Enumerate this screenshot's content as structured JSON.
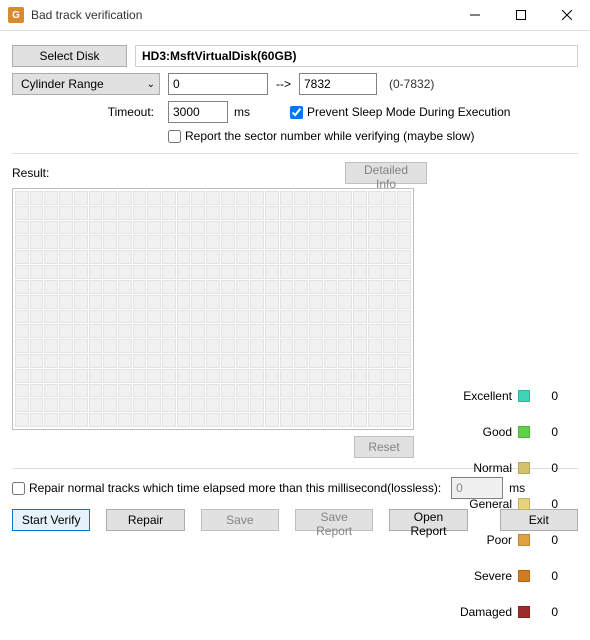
{
  "window": {
    "title": "Bad track verification"
  },
  "toolbar": {
    "select_disk": "Select Disk",
    "disk_label": "HD3:MsftVirtualDisk(60GB)"
  },
  "range": {
    "mode": "Cylinder Range",
    "from": "0",
    "to": "7832",
    "hint": "(0-7832)"
  },
  "timeout": {
    "label": "Timeout:",
    "value": "3000",
    "unit": "ms"
  },
  "checks": {
    "prevent_sleep": {
      "label": "Prevent Sleep Mode During Execution",
      "checked": true
    },
    "report_sector": {
      "label": "Report the sector number while verifying (maybe slow)",
      "checked": false
    }
  },
  "result": {
    "label": "Result:",
    "detailed": "Detailed Info",
    "reset": "Reset"
  },
  "legend": [
    {
      "name": "Excellent",
      "color": "#3fd4b8",
      "value": "0"
    },
    {
      "name": "Good",
      "color": "#62d14a",
      "value": "0"
    },
    {
      "name": "Normal",
      "color": "#d3c26b",
      "value": "0"
    },
    {
      "name": "General",
      "color": "#e7d37a",
      "value": "0"
    },
    {
      "name": "Poor",
      "color": "#e0a142",
      "value": "0"
    },
    {
      "name": "Severe",
      "color": "#d17a1f",
      "value": "0"
    },
    {
      "name": "Damaged",
      "color": "#9e2b2b",
      "value": "0"
    }
  ],
  "repair": {
    "label": "Repair normal tracks which time elapsed more than this millisecond(lossless):",
    "value": "0",
    "unit": "ms",
    "checked": false
  },
  "buttons": {
    "start": "Start Verify",
    "repair": "Repair",
    "save": "Save",
    "save_report": "Save Report",
    "open_report": "Open Report",
    "exit": "Exit"
  }
}
